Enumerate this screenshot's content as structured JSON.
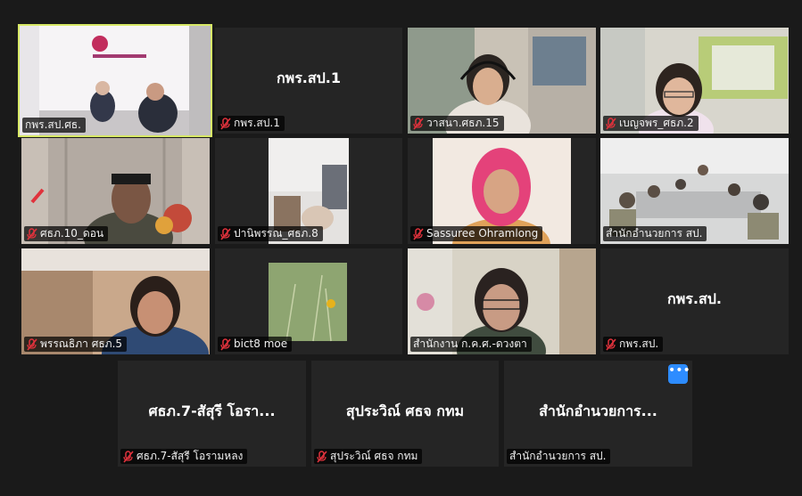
{
  "tiles": [
    {
      "name": "กพร.สป.ศธ.",
      "big": ""
    },
    {
      "name": "กพร.สป.1",
      "big": "กพร.สป.1"
    },
    {
      "name": "วาสนา.ศธภ.15",
      "big": ""
    },
    {
      "name": "เบญจพร_ศธภ.2",
      "big": ""
    },
    {
      "name": "ศธภ.10_ดอน",
      "big": ""
    },
    {
      "name": "ปานิพรรณ_ศธภ.8",
      "big": ""
    },
    {
      "name": "Sassuree Ohramlong",
      "big": ""
    },
    {
      "name": "สำนักอำนวยการ สป.",
      "big": ""
    },
    {
      "name": "พรรณธิภา ศธภ.5",
      "big": ""
    },
    {
      "name": "bict8 moe",
      "big": ""
    },
    {
      "name": "สำนักงาน ก.ค.ศ.-ดวงตา",
      "big": ""
    },
    {
      "name": "กพร.สป.",
      "big": "กพร.สป."
    },
    {
      "name": "ศธภ.7-สัสุรี โอรามหลง",
      "big": "ศธภ.7-สัสุรี โอรา..."
    },
    {
      "name": "สุประวิณ์ ศธจ กทม",
      "big": "สุประวิณ์ ศธจ กทม"
    },
    {
      "name": "สำนักอำนวยการ สป.",
      "big": "สำนักอำนวยการ..."
    }
  ],
  "more_button": "•••",
  "colors": {
    "active_border": "#d7e866",
    "muted_mic": "#e0323c",
    "accent": "#2d8cff"
  }
}
